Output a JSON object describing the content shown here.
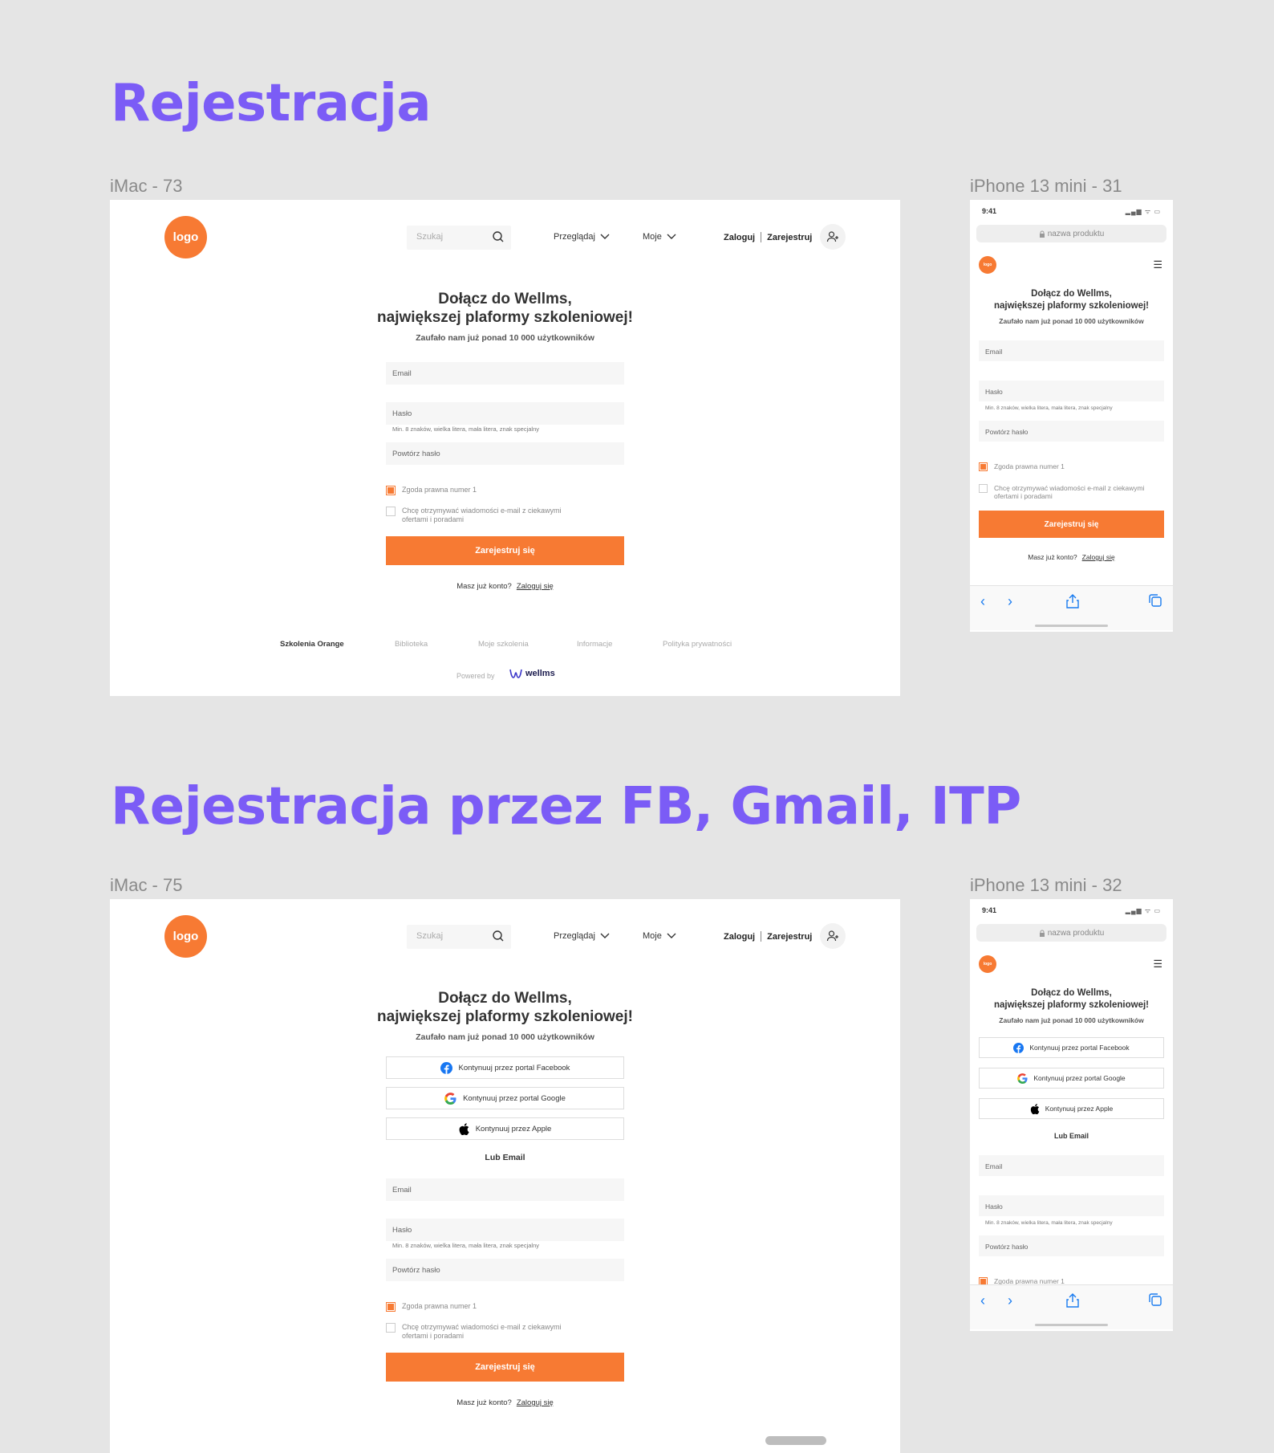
{
  "sections": [
    {
      "title": "Rejestracja",
      "desktop_label": "iMac - 73",
      "phone_label": "iPhone 13 mini - 31"
    },
    {
      "title": "Rejestracja przez FB, Gmail, ITP",
      "desktop_label": "iMac - 75",
      "phone_label": "iPhone 13 mini - 32"
    }
  ],
  "header": {
    "logo": "logo",
    "search_placeholder": "Szukaj",
    "browse": "Przeglądaj",
    "mine": "Moje",
    "login": "Zaloguj",
    "register": "Zarejestruj"
  },
  "form": {
    "title_line1": "Dołącz do Wellms,",
    "title_line2": "największej plaformy szkoleniowej!",
    "subtitle": "Zaufało nam już ponad 10 000 użytkowników",
    "email": "Email",
    "password": "Hasło",
    "password_hint": "Min. 8 znaków, wielka litera, mała litera, znak specjalny",
    "repeat_password": "Powtórz hasło",
    "consent1": "Zgoda prawna numer 1",
    "consent2_line1": "Chcę otrzymywać wiadomości e-mail z ciekawymi",
    "consent2_line2": "ofertami i poradami",
    "consent1_checked": true,
    "consent2_checked": false,
    "submit": "Zarejestruj się",
    "have_account": "Masz już konto?",
    "login_link": "Zaloguj się",
    "facebook": "Kontynuuj przez portal Facebook",
    "google": "Kontynuuj przez portal Google",
    "apple": "Kontynuuj przez Apple",
    "or_email": "Lub Email"
  },
  "footer": {
    "links": [
      "Szkolenia Orange",
      "Biblioteka",
      "Moje szkolenia",
      "Informacje",
      "Polityka prywatności"
    ],
    "powered_by": "Powered by",
    "brand": "wellms"
  },
  "phone": {
    "time": "9:41",
    "url": "nazwa produktu",
    "logo": "logo"
  },
  "colors": {
    "accent": "#f77a33",
    "title": "#7b5cf6",
    "ios_blue": "#1a7cf0"
  }
}
